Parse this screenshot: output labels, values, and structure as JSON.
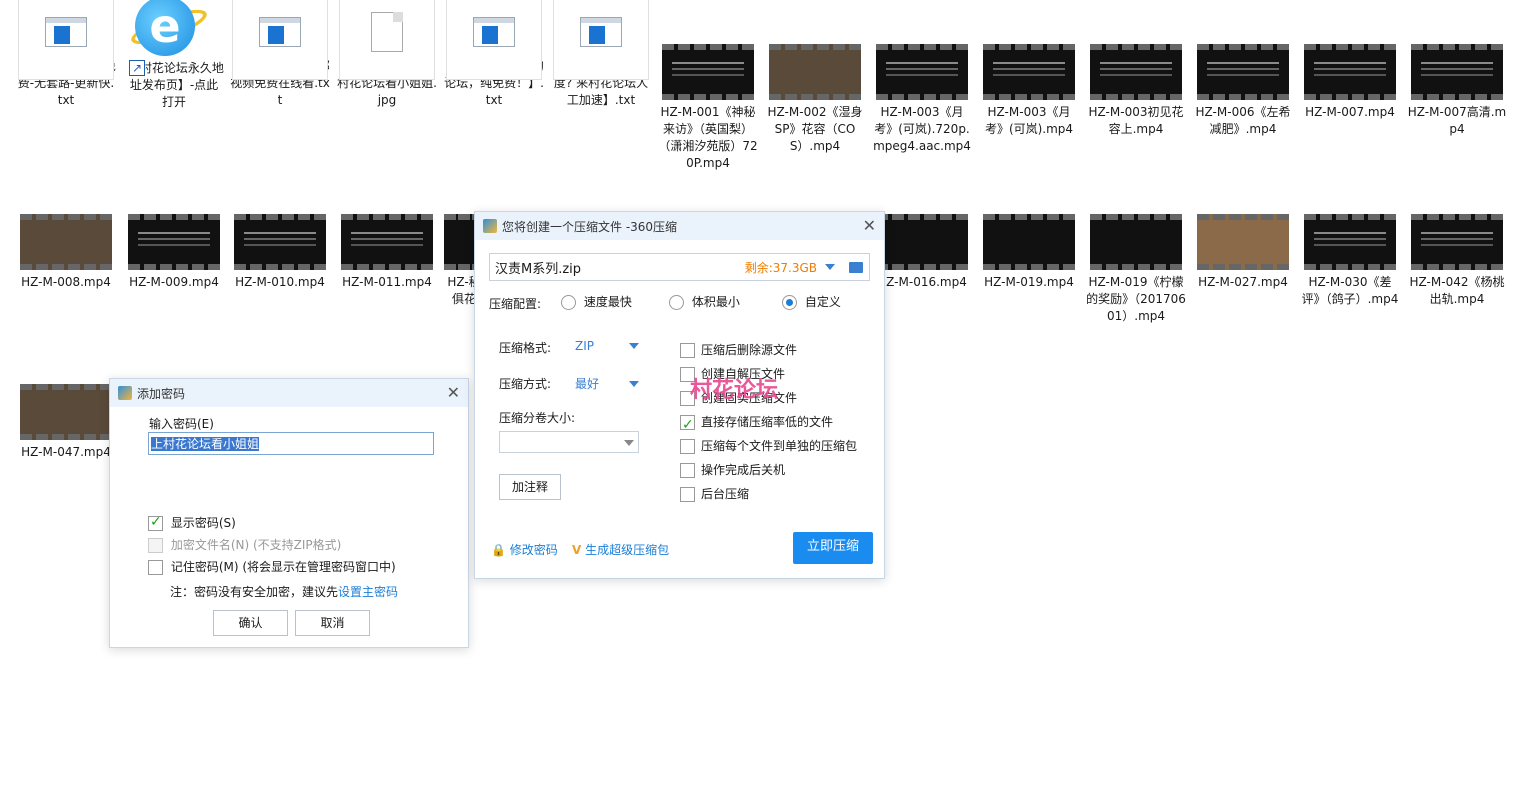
{
  "files": [
    {
      "name": "【 村花论坛】全免费-无套路-更新快.txt",
      "kind": "doc"
    },
    {
      "name": "【 村花论坛永久地址发布页】-点此打开",
      "kind": "ie"
    },
    {
      "name": "【 村花视频】万部视频免费在线看.txt",
      "kind": "doc"
    },
    {
      "name": "【 解压密码】: 上村花论坛看小姐姐.jpg",
      "kind": "jpg"
    },
    {
      "name": "【 来了就能下载的论坛，纯免费！】.txt",
      "kind": "doc"
    },
    {
      "name": "【 有种子却没速度? 来村花论坛人工加速】.txt",
      "kind": "doc"
    },
    {
      "name": "HZ-M-001《神秘来访》（英国梨）（潇湘汐苑版）720P.mp4",
      "kind": "video"
    },
    {
      "name": "HZ-M-002《湿身SP》花容（COS）.mp4",
      "kind": "video-light"
    },
    {
      "name": "HZ-M-003《月考》(可岚).720p.mpeg4.aac.mp4",
      "kind": "video"
    },
    {
      "name": "HZ-M-003《月考》(可岚).mp4",
      "kind": "video"
    },
    {
      "name": "HZ-M-003初见花容上.mp4",
      "kind": "video"
    },
    {
      "name": "HZ-M-006《左希减肥》.mp4",
      "kind": "video"
    },
    {
      "name": "HZ-M-007.mp4",
      "kind": "video"
    },
    {
      "name": "HZ-M-007高清.mp4",
      "kind": "video"
    },
    {
      "name": "HZ-M-008.mp4",
      "kind": "video-light"
    },
    {
      "name": "HZ-M-009.mp4",
      "kind": "video"
    },
    {
      "name": "HZ-M-010.mp4",
      "kind": "video"
    },
    {
      "name": "HZ-M-011.mp4",
      "kind": "video"
    },
    {
      "name": "HZ-秘俱花",
      "kind": "video"
    },
    {
      "name": "HZ-M-016.mp4",
      "kind": "video"
    },
    {
      "name": "HZ-M-019.mp4",
      "kind": "video"
    },
    {
      "name": "HZ-M-019《柠檬的奖励》（20170601）.mp4",
      "kind": "video"
    },
    {
      "name": "HZ-M-027.mp4",
      "kind": "video-brown"
    },
    {
      "name": "HZ-M-030《差评》（鸽子）.mp4",
      "kind": "video"
    },
    {
      "name": "HZ-M-042《杨桃出轨.mp4",
      "kind": "video"
    },
    {
      "name": "HZ-M-047.mp4",
      "kind": "video-light"
    }
  ],
  "password_dialog": {
    "title": "添加密码",
    "input_label": "输入密码(E)",
    "password_value": "上村花论坛看小姐姐",
    "show_password": "显示密码(S)",
    "encrypt_filenames": "加密文件名(N) (不支持ZIP格式)",
    "remember_password": "记住密码(M) (将会显示在管理密码窗口中)",
    "note_prefix": "注：密码没有安全加密，建议先",
    "note_link": "设置主密码",
    "ok": "确认",
    "cancel": "取消"
  },
  "compress_dialog": {
    "title": "您将创建一个压缩文件 -360压缩",
    "filename": "汉责M系列.zip",
    "space_left": "剩余:37.3GB",
    "config_label": "压缩配置:",
    "config_options": [
      "速度最快",
      "体积最小",
      "自定义"
    ],
    "format_label": "压缩格式:",
    "format_value": "ZIP",
    "method_label": "压缩方式:",
    "method_value": "最好",
    "split_label": "压缩分卷大小:",
    "split_value": "",
    "comment_button": "加注释",
    "options": [
      {
        "label": "压缩后删除源文件",
        "checked": false
      },
      {
        "label": "创建自解压文件",
        "checked": false
      },
      {
        "label": "创建固实压缩文件",
        "checked": false
      },
      {
        "label": "直接存储压缩率低的文件",
        "checked": true
      },
      {
        "label": "压缩每个文件到单独的压缩包",
        "checked": false
      },
      {
        "label": "操作完成后关机",
        "checked": false
      },
      {
        "label": "后台压缩",
        "checked": false
      }
    ],
    "modify_password": "修改密码",
    "super_compress": "生成超级压缩包",
    "start": "立即压缩"
  },
  "watermark": "村花论坛"
}
